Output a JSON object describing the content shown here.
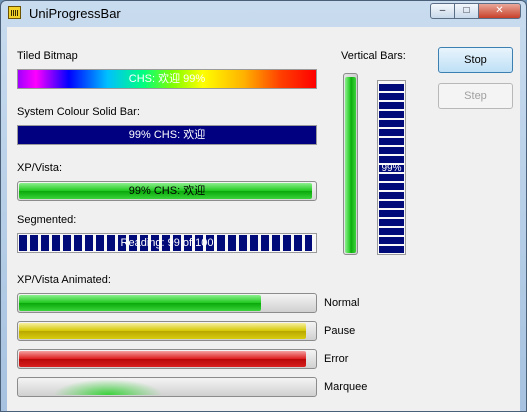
{
  "window": {
    "title": "UniProgressBar",
    "min_glyph": "–",
    "max_glyph": "□",
    "close_glyph": "✕"
  },
  "labels": {
    "tiled": "Tiled Bitmap",
    "solid": "System Colour Solid Bar:",
    "xp": "XP/Vista:",
    "segmented": "Segmented:",
    "vertical": "Vertical Bars:",
    "animated": "XP/Vista Animated:"
  },
  "bars": {
    "tiled": {
      "text": "CHS: 欢迎 99%",
      "progress": 0.99
    },
    "solid": {
      "text": "99% CHS: 欢迎",
      "progress": 0.99
    },
    "xp": {
      "text": "99% CHS: 欢迎",
      "progress": 0.99
    },
    "segmented": {
      "text": "Reading: 99 of 100",
      "progress": 0.99
    },
    "vertical_xp": {
      "progress": 0.99
    },
    "vertical_segmented": {
      "text": "99%",
      "progress": 0.99
    }
  },
  "buttons": {
    "stop": "Stop",
    "step": "Step"
  },
  "animated": {
    "normal": {
      "label": "Normal",
      "progress": 0.82
    },
    "pause": {
      "label": "Pause",
      "progress": 0.97
    },
    "error": {
      "label": "Error",
      "progress": 0.97
    },
    "marquee": {
      "label": "Marquee"
    }
  }
}
